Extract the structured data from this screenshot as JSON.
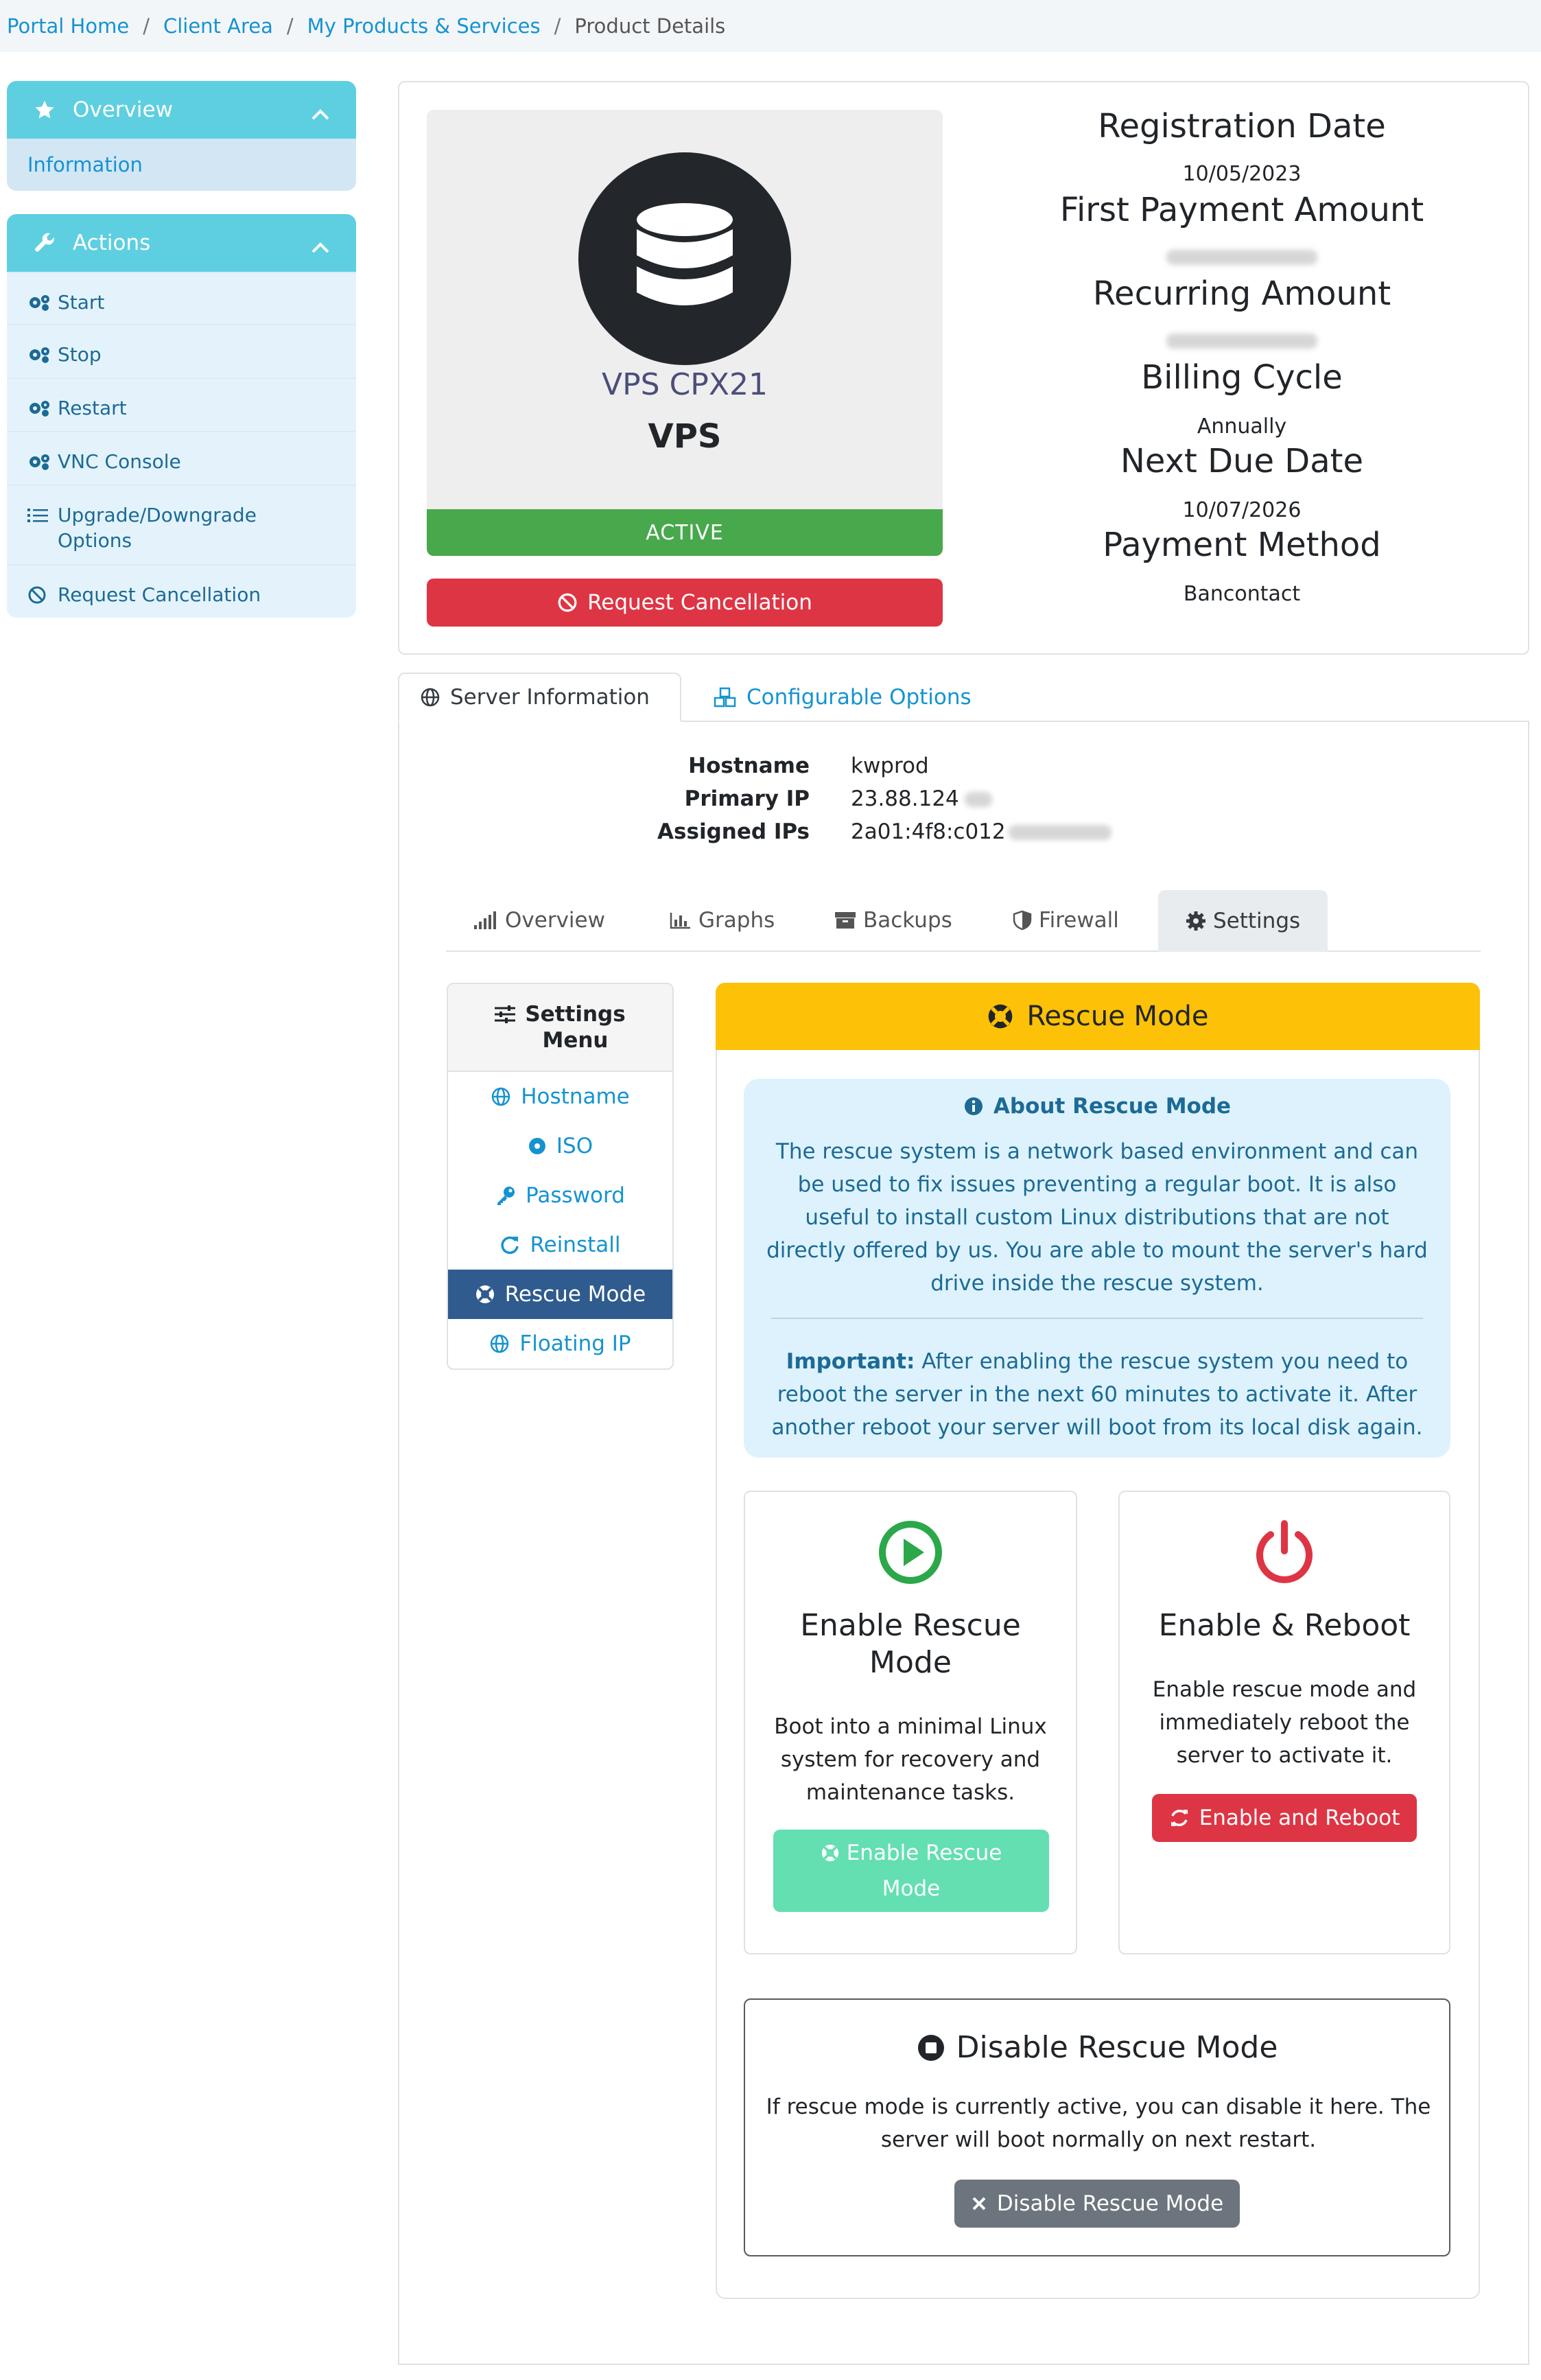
{
  "breadcrumb": {
    "items": [
      "Portal Home",
      "Client Area",
      "My Products & Services"
    ],
    "current": "Product Details",
    "separator": "/"
  },
  "sidebar": {
    "overview": {
      "title": "Overview",
      "items": [
        "Information"
      ]
    },
    "actions": {
      "title": "Actions",
      "items": [
        "Start",
        "Stop",
        "Restart",
        "VNC Console",
        "Upgrade/Downgrade Options",
        "Request Cancellation"
      ]
    }
  },
  "product": {
    "group": "VPS CPX21",
    "name": "VPS",
    "status": "ACTIVE",
    "cancel_label": "Request Cancellation"
  },
  "billing": {
    "registration_date_label": "Registration Date",
    "registration_date": "10/05/2023",
    "first_payment_label": "First Payment Amount",
    "recurring_label": "Recurring Amount",
    "billing_cycle_label": "Billing Cycle",
    "billing_cycle": "Annually",
    "next_due_label": "Next Due Date",
    "next_due": "10/07/2026",
    "payment_method_label": "Payment Method",
    "payment_method": "Bancontact"
  },
  "tabs": {
    "server_info": "Server Information",
    "configurable": "Configurable Options"
  },
  "server": {
    "hostname_label": "Hostname",
    "hostname": "kwprod",
    "primary_ip_label": "Primary IP",
    "primary_ip": "23.88.124",
    "assigned_ips_label": "Assigned IPs",
    "assigned_ips": "2a01:4f8:c012"
  },
  "inner_tabs": [
    "Overview",
    "Graphs",
    "Backups",
    "Firewall",
    "Settings"
  ],
  "settings_menu": {
    "title": "Settings Menu",
    "items": [
      "Hostname",
      "ISO",
      "Password",
      "Reinstall",
      "Rescue Mode",
      "Floating IP"
    ]
  },
  "rescue": {
    "title": "Rescue Mode",
    "about_title": "About Rescue Mode",
    "about_text": "The rescue system is a network based environment and can be used to fix issues preventing a regular boot. It is also useful to install custom Linux distributions that are not directly offered by us. You are able to mount the server's hard drive inside the rescue system.",
    "important_label": "Important:",
    "important_text": "After enabling the rescue system you need to reboot the server in the next 60 minutes to activate it. After another reboot your server will boot from its local disk again.",
    "enable_title": "Enable Rescue Mode",
    "enable_desc": "Boot into a minimal Linux system for recovery and maintenance tasks.",
    "enable_btn": "Enable Rescue Mode",
    "reboot_title": "Enable & Reboot",
    "reboot_desc": "Enable rescue mode and immediately reboot the server to activate it.",
    "reboot_btn": "Enable and Reboot",
    "disable_title": "Disable Rescue Mode",
    "disable_desc": "If rescue mode is currently active, you can disable it here. The server will boot normally on next restart.",
    "disable_btn": "Disable Rescue Mode"
  },
  "colors": {
    "link": "#1593d1",
    "sidebar_head": "#5dcfe0",
    "active_green": "#48a84c",
    "danger": "#de3544",
    "warning": "#fdc107",
    "menu_active": "#2f5b8e"
  }
}
